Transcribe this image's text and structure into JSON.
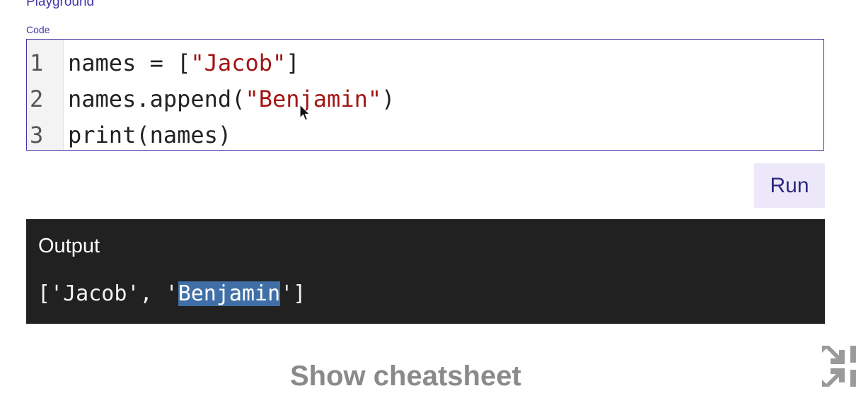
{
  "header": {
    "playground_title": "Playground",
    "code_label": "Code"
  },
  "editor": {
    "line_numbers": [
      "1",
      "2",
      "3"
    ],
    "lines": [
      {
        "pre": "names = [",
        "str": "\"Jacob\"",
        "post": "]"
      },
      {
        "pre": "names.append(",
        "str": "\"Benjamin\"",
        "post": ")"
      },
      {
        "pre": "print(names)",
        "str": "",
        "post": ""
      }
    ]
  },
  "run_button": {
    "label": "Run"
  },
  "output": {
    "title": "Output",
    "prefix": "['Jacob', '",
    "highlight": "Benjamin",
    "suffix": "']"
  },
  "footer": {
    "cheatsheet_label": "Show cheatsheet"
  },
  "icons": {
    "cursor": "mouse-pointer-icon",
    "collapse": "collapse-arrows-icon"
  },
  "colors": {
    "accent": "#3f36a8",
    "string": "#a31515",
    "output_bg": "#212121",
    "highlight": "#3f6fa6",
    "run_bg": "#ece8f9"
  }
}
